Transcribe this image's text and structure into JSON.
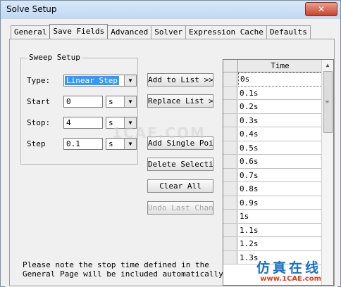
{
  "window": {
    "title": "Solve Setup",
    "close_glyph": "✕"
  },
  "tabs": [
    {
      "label": "General"
    },
    {
      "label": "Save Fields",
      "active": true
    },
    {
      "label": "Advanced"
    },
    {
      "label": "Solver"
    },
    {
      "label": "Expression Cache"
    },
    {
      "label": "Defaults"
    }
  ],
  "sweep": {
    "legend": "Sweep Setup",
    "type_label": "Type:",
    "type_value": "Linear Step",
    "start_label": "Start",
    "start_value": "0",
    "start_unit": "s",
    "stop_label": "Stop:",
    "stop_value": "4",
    "stop_unit": "s",
    "step_label": "Step",
    "step_value": "0.1",
    "step_unit": "s"
  },
  "buttons": {
    "add_to_list": "Add to List >>",
    "replace_list": "Replace List >>",
    "add_single_point": "Add Single Point",
    "delete_selection": "Delete Selection",
    "clear_all": "Clear All",
    "undo_last_change": "Undo Last Change"
  },
  "note": {
    "line1": "Please note the stop time defined in the",
    "line2": "General Page will be included automatically."
  },
  "table": {
    "column_header": "Time",
    "rows": [
      "0s",
      "0.1s",
      "0.2s",
      "0.3s",
      "0.4s",
      "0.5s",
      "0.6s",
      "0.7s",
      "0.8s",
      "0.9s",
      "1s",
      "1.1s",
      "1.2s",
      "1.3s"
    ]
  },
  "watermark": {
    "text": "1CAE.COM"
  },
  "brand": {
    "cn": "仿真在线",
    "url": "www.1CAE.com"
  },
  "icons": {
    "dropdown": "chevron-down-icon",
    "scroll_up": "arrow-up-icon",
    "grip": "grip-icon"
  }
}
